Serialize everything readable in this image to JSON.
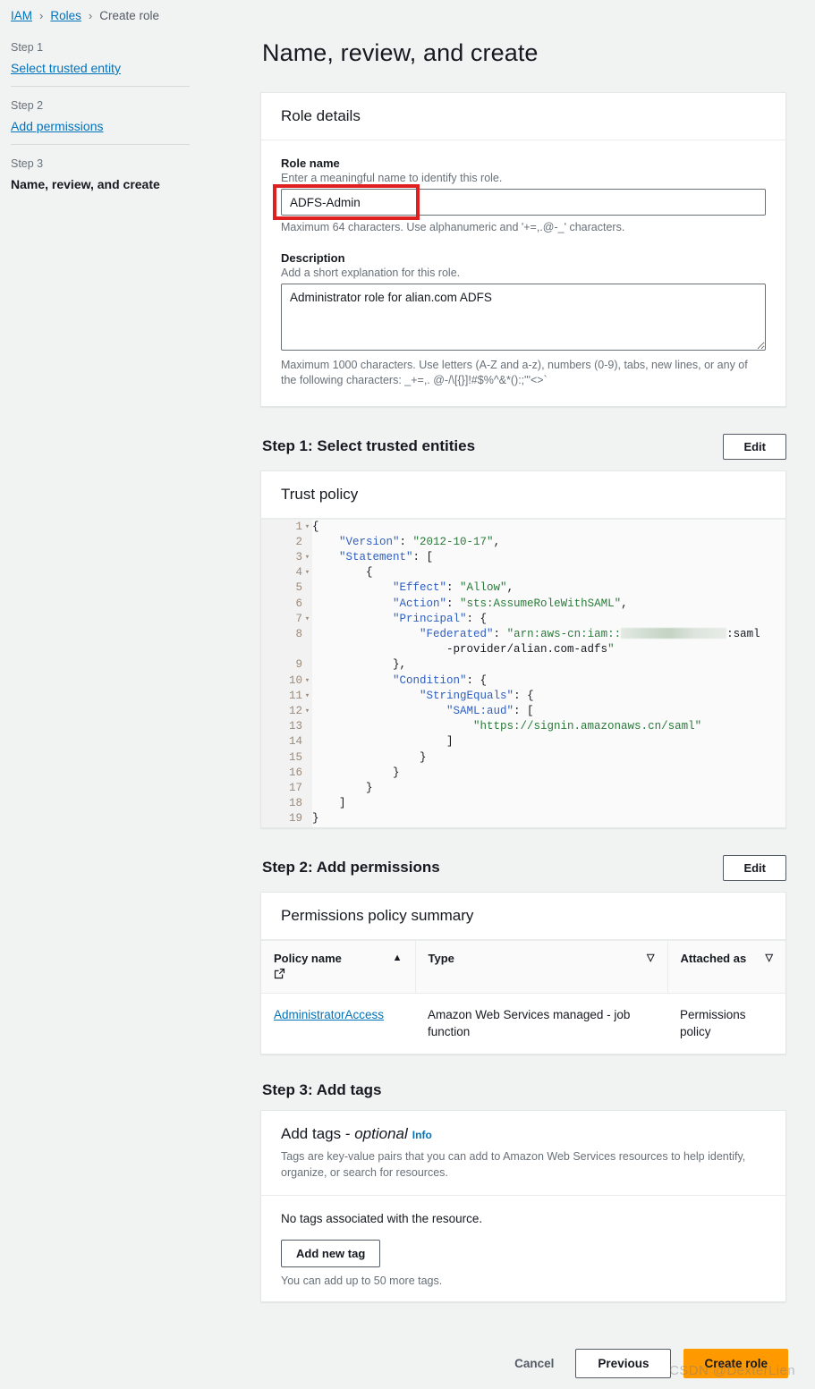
{
  "breadcrumb": {
    "items": [
      {
        "label": "IAM",
        "type": "link"
      },
      {
        "label": "Roles",
        "type": "link"
      },
      {
        "label": "Create role",
        "type": "current"
      }
    ],
    "separator": "›"
  },
  "sidebar": {
    "steps": [
      {
        "num": "Step 1",
        "label": "Select trusted entity",
        "current": false
      },
      {
        "num": "Step 2",
        "label": "Add permissions",
        "current": false
      },
      {
        "num": "Step 3",
        "label": "Name, review, and create",
        "current": true
      }
    ]
  },
  "page": {
    "title": "Name, review, and create"
  },
  "role_details": {
    "card_title": "Role details",
    "role_name": {
      "label": "Role name",
      "description": "Enter a meaningful name to identify this role.",
      "value": "ADFS-Admin",
      "hint": "Maximum 64 characters. Use alphanumeric and '+=,.@-_' characters."
    },
    "description": {
      "label": "Description",
      "description": "Add a short explanation for this role.",
      "value": "Administrator role for alian.com ADFS",
      "hint": "Maximum 1000 characters. Use letters (A-Z and a-z), numbers (0-9), tabs, new lines, or any of the following characters: _+=,. @-/\\[{}]!#$%^&*():;\"'<>`"
    }
  },
  "step1": {
    "heading": "Step 1: Select trusted entities",
    "edit_label": "Edit",
    "card_title": "Trust policy",
    "code_lines": [
      {
        "n": "1",
        "fold": true,
        "text": "{"
      },
      {
        "n": "2",
        "fold": false,
        "text": "    \"Version\": \"2012-10-17\","
      },
      {
        "n": "3",
        "fold": true,
        "text": "    \"Statement\": ["
      },
      {
        "n": "4",
        "fold": true,
        "text": "        {"
      },
      {
        "n": "5",
        "fold": false,
        "text": "            \"Effect\": \"Allow\","
      },
      {
        "n": "6",
        "fold": false,
        "text": "            \"Action\": \"sts:AssumeRoleWithSAML\","
      },
      {
        "n": "7",
        "fold": true,
        "text": "            \"Principal\": {"
      },
      {
        "n": "8",
        "fold": false,
        "text": "                \"Federated\": \"arn:aws-cn:iam::[REDACTED]:saml"
      },
      {
        "n": "",
        "fold": false,
        "text": "                    -provider/alian.com-adfs\""
      },
      {
        "n": "9",
        "fold": false,
        "text": "            },"
      },
      {
        "n": "10",
        "fold": true,
        "text": "            \"Condition\": {"
      },
      {
        "n": "11",
        "fold": true,
        "text": "                \"StringEquals\": {"
      },
      {
        "n": "12",
        "fold": true,
        "text": "                    \"SAML:aud\": ["
      },
      {
        "n": "13",
        "fold": false,
        "text": "                        \"https://signin.amazonaws.cn/saml\""
      },
      {
        "n": "14",
        "fold": false,
        "text": "                    ]"
      },
      {
        "n": "15",
        "fold": false,
        "text": "                }"
      },
      {
        "n": "16",
        "fold": false,
        "text": "            }"
      },
      {
        "n": "17",
        "fold": false,
        "text": "        }"
      },
      {
        "n": "18",
        "fold": false,
        "text": "    ]"
      },
      {
        "n": "19",
        "fold": false,
        "text": "}"
      }
    ]
  },
  "step2": {
    "heading": "Step 2: Add permissions",
    "edit_label": "Edit",
    "card_title": "Permissions policy summary",
    "columns": [
      {
        "label": "Policy name",
        "sort": "▲",
        "has_external_icon": true
      },
      {
        "label": "Type",
        "sort": "▽",
        "has_external_icon": false
      },
      {
        "label": "Attached as",
        "sort": "▽",
        "has_external_icon": false
      }
    ],
    "rows": [
      {
        "policy_name": "AdministratorAccess",
        "type": "Amazon Web Services managed - job function",
        "attached_as": "Permissions policy"
      }
    ]
  },
  "step3": {
    "heading": "Step 3: Add tags",
    "card_title": "Add tags - ",
    "card_title_optional": "optional",
    "info_label": "Info",
    "card_subtitle": "Tags are key-value pairs that you can add to Amazon Web Services resources to help identify, organize, or search for resources.",
    "empty_text": "No tags associated with the resource.",
    "add_tag_label": "Add new tag",
    "limit_text": "You can add up to 50 more tags."
  },
  "footer": {
    "cancel_label": "Cancel",
    "previous_label": "Previous",
    "create_label": "Create role"
  },
  "watermark": {
    "text": "CSDN @DexterLien"
  },
  "colors": {
    "accent_link": "#0073bb",
    "create_button": "#ff9900",
    "annotation_box": "#e02020",
    "page_background": "#f1f3f3",
    "json_key": "#2f5fc0",
    "json_string": "#2a7a3a"
  }
}
